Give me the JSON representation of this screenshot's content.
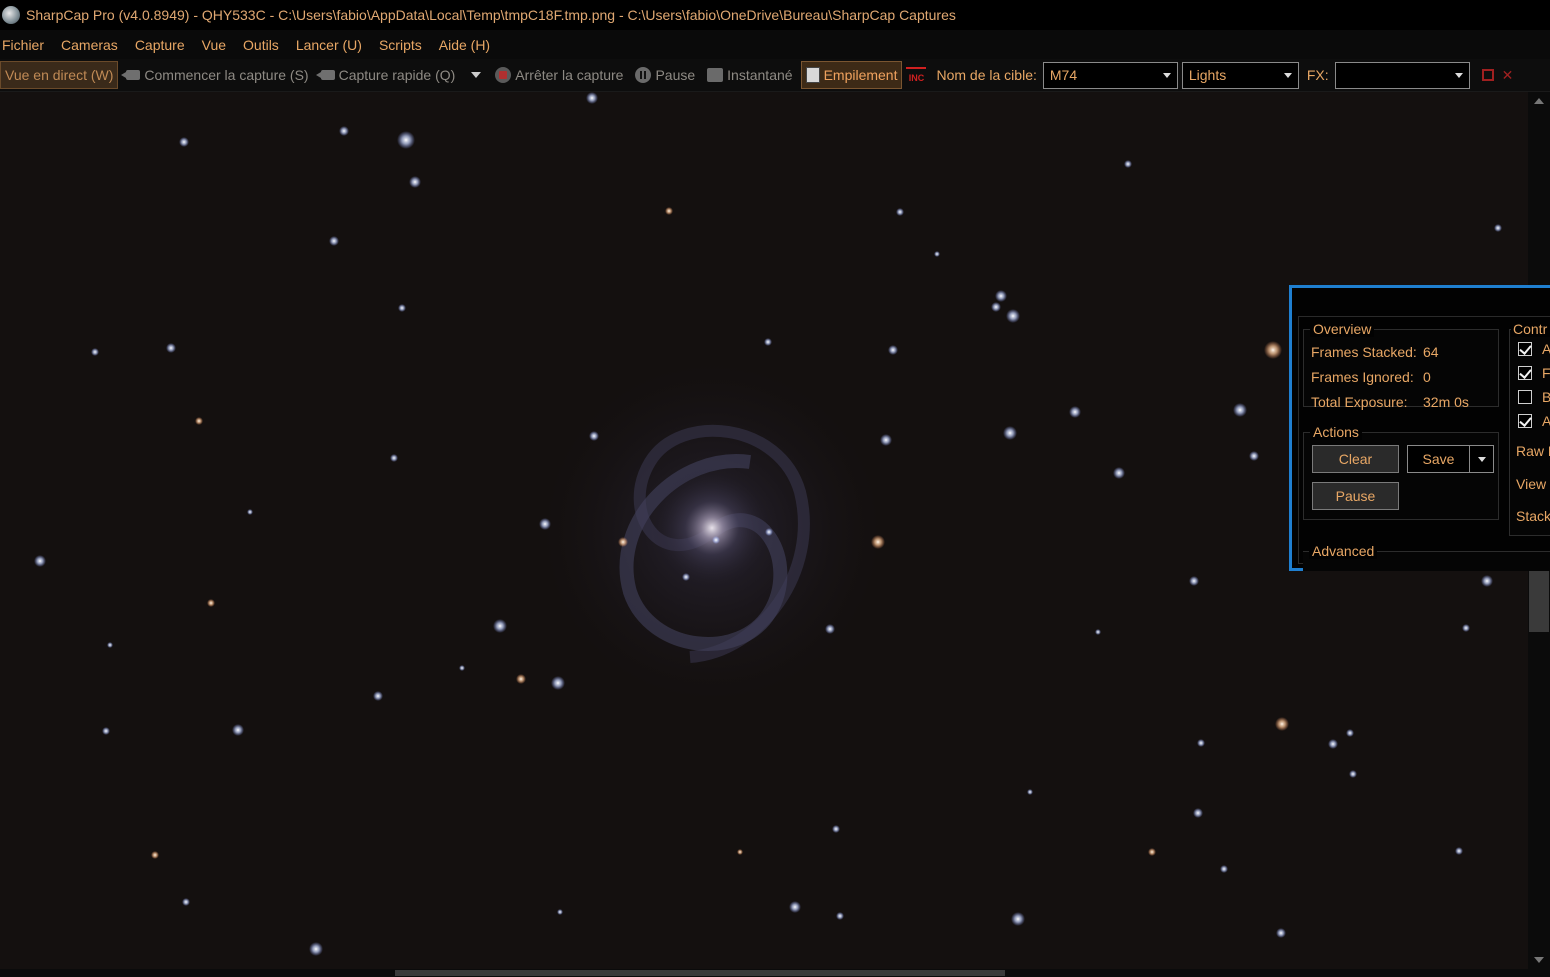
{
  "window": {
    "title": "SharpCap Pro (v4.0.8949) - QHY533C - C:\\Users\\fabio\\AppData\\Local\\Temp\\tmpC18F.tmp.png - C:\\Users\\fabio\\OneDrive\\Bureau\\SharpCap Captures"
  },
  "menu": [
    "Fichier",
    "Cameras",
    "Capture",
    "Vue",
    "Outils",
    "Lancer (U)",
    "Scripts",
    "Aide (H)"
  ],
  "toolbar": {
    "live_view": "Vue en direct (W)",
    "start_capture": "Commencer la capture (S)",
    "quick_capture": "Capture rapide (Q)",
    "stop_capture": "Arrêter la capture",
    "pause": "Pause",
    "snapshot": "Instantané",
    "stacking": "Empilement",
    "inc_icon_text": "INC",
    "target_label": "Nom de la cible:",
    "target_value": "M74",
    "frame_type": "Lights",
    "fx_label": "FX:",
    "fx_value": ""
  },
  "stack_panel": {
    "overview": {
      "title": "Overview",
      "frames_stacked_label": "Frames Stacked:",
      "frames_stacked": "64",
      "frames_ignored_label": "Frames Ignored:",
      "frames_ignored": "0",
      "total_exposure_label": "Total Exposure:",
      "total_exposure": "32m 0s"
    },
    "actions": {
      "title": "Actions",
      "clear": "Clear",
      "save": "Save",
      "pause": "Pause"
    },
    "advanced": "Advanced",
    "controls": {
      "title": "Contr",
      "items": [
        {
          "label": "Al",
          "checked": true
        },
        {
          "label": "FW",
          "checked": true
        },
        {
          "label": "Br",
          "checked": false
        },
        {
          "label": "Ad",
          "checked": true
        }
      ],
      "raw": "Raw F",
      "view": "View",
      "stack": "Stacki"
    }
  },
  "colors": {
    "accent_text": "#e8a765",
    "panel_border": "#1f7fd0",
    "sky": "#14100f"
  }
}
